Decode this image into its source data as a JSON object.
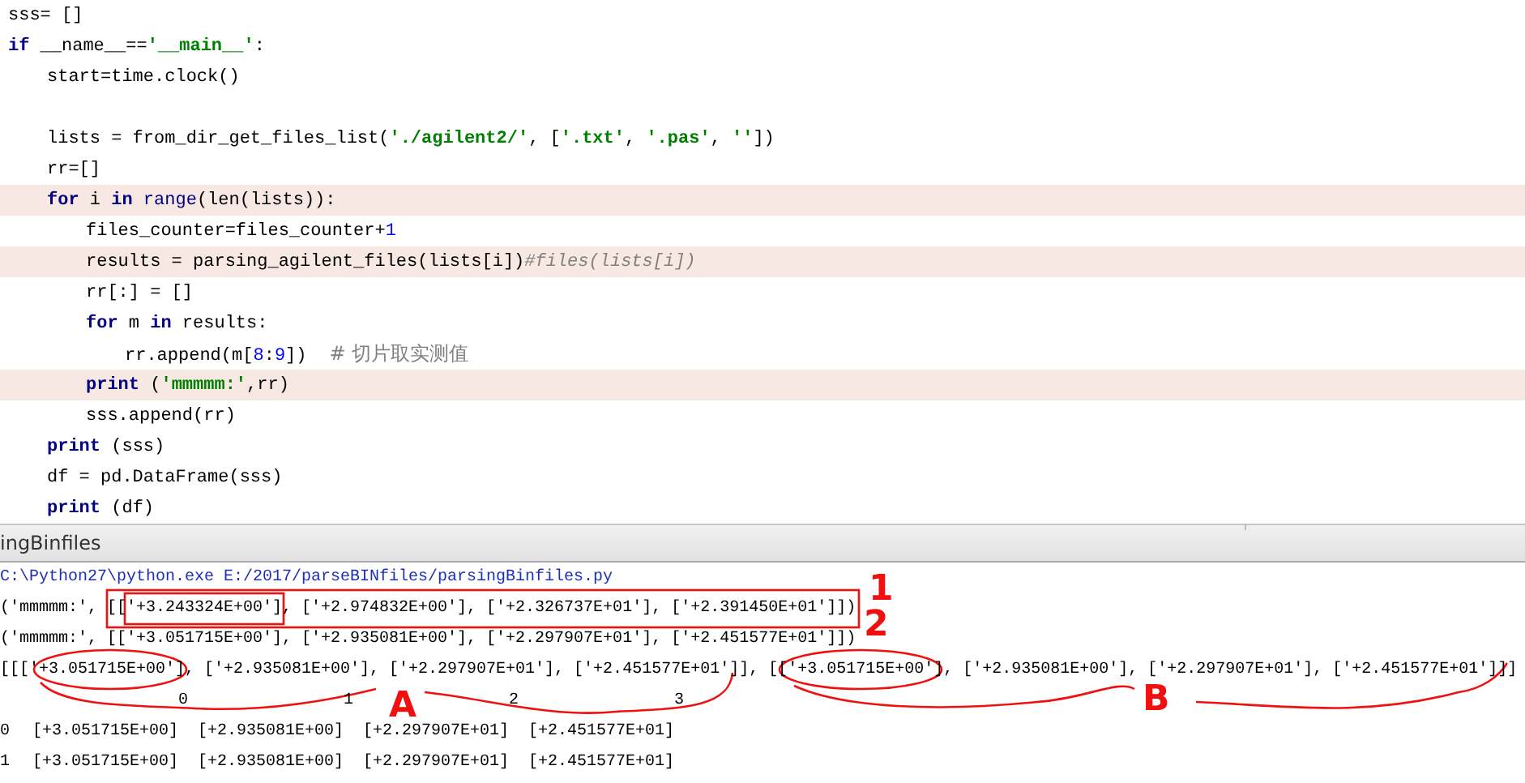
{
  "editor": {
    "lines": [
      {
        "kind": "code",
        "highlighted": false,
        "tokens": [
          {
            "kind": "plain",
            "text": "sss= []"
          }
        ]
      },
      {
        "kind": "code",
        "highlighted": false,
        "tokens": [
          {
            "kind": "keyword",
            "text": "if"
          },
          {
            "kind": "plain",
            "text": " __name__=="
          },
          {
            "kind": "string",
            "text": "'__main__'"
          },
          {
            "kind": "plain",
            "text": ":"
          }
        ],
        "children": [
          {
            "kind": "code",
            "highlighted": false,
            "tokens": [
              {
                "kind": "plain",
                "text": "start=time.clock()"
              }
            ]
          },
          {
            "kind": "blank"
          },
          {
            "kind": "code",
            "highlighted": false,
            "tokens": [
              {
                "kind": "plain",
                "text": "lists = from_dir_get_files_list("
              },
              {
                "kind": "string",
                "text": "'./agilent2/'"
              },
              {
                "kind": "plain",
                "text": ", ["
              },
              {
                "kind": "string",
                "text": "'.txt'"
              },
              {
                "kind": "plain",
                "text": ", "
              },
              {
                "kind": "string",
                "text": "'.pas'"
              },
              {
                "kind": "plain",
                "text": ", "
              },
              {
                "kind": "string",
                "text": "''"
              },
              {
                "kind": "plain",
                "text": "])"
              }
            ]
          },
          {
            "kind": "code",
            "highlighted": false,
            "tokens": [
              {
                "kind": "plain",
                "text": "rr=[]"
              }
            ]
          },
          {
            "kind": "code",
            "highlighted": true,
            "tokens": [
              {
                "kind": "keyword",
                "text": "for"
              },
              {
                "kind": "plain",
                "text": " i "
              },
              {
                "kind": "keyword",
                "text": "in"
              },
              {
                "kind": "builtin",
                "text": " range"
              },
              {
                "kind": "plain",
                "text": "(len(lists)):"
              }
            ],
            "children": [
              {
                "kind": "code",
                "highlighted": false,
                "tokens": [
                  {
                    "kind": "plain",
                    "text": "files_counter=files_counter+"
                  },
                  {
                    "kind": "number",
                    "text": "1"
                  }
                ]
              },
              {
                "kind": "code",
                "highlighted": true,
                "tokens": [
                  {
                    "kind": "plain",
                    "text": "results = parsing_agilent_files(lists[i])"
                  },
                  {
                    "kind": "comment",
                    "text": "#files(lists[i])"
                  }
                ]
              },
              {
                "kind": "code",
                "highlighted": false,
                "tokens": [
                  {
                    "kind": "plain",
                    "text": "rr[:] = []"
                  }
                ]
              },
              {
                "kind": "code",
                "highlighted": false,
                "tokens": [
                  {
                    "kind": "keyword",
                    "text": "for"
                  },
                  {
                    "kind": "plain",
                    "text": " m "
                  },
                  {
                    "kind": "keyword",
                    "text": "in"
                  },
                  {
                    "kind": "plain",
                    "text": " results:"
                  }
                ],
                "children": [
                  {
                    "kind": "code",
                    "highlighted": false,
                    "tokens": [
                      {
                        "kind": "plain",
                        "text": "rr.append(m["
                      },
                      {
                        "kind": "number",
                        "text": "8"
                      },
                      {
                        "kind": "plain",
                        "text": ":"
                      },
                      {
                        "kind": "number",
                        "text": "9"
                      },
                      {
                        "kind": "plain",
                        "text": "])"
                      },
                      {
                        "kind": "comment-cjk",
                        "text": "# 切片取实测值"
                      }
                    ]
                  }
                ]
              },
              {
                "kind": "code",
                "highlighted": true,
                "tokens": [
                  {
                    "kind": "keyword",
                    "text": "print"
                  },
                  {
                    "kind": "plain",
                    "text": " ("
                  },
                  {
                    "kind": "string",
                    "text": "'mmmmm:'"
                  },
                  {
                    "kind": "plain",
                    "text": ",rr)"
                  }
                ]
              },
              {
                "kind": "code",
                "highlighted": false,
                "tokens": [
                  {
                    "kind": "plain",
                    "text": "sss.append(rr)"
                  }
                ]
              }
            ]
          },
          {
            "kind": "code",
            "highlighted": false,
            "tokens": [
              {
                "kind": "keyword",
                "text": "print"
              },
              {
                "kind": "plain",
                "text": " (sss)"
              }
            ]
          },
          {
            "kind": "code",
            "highlighted": false,
            "tokens": [
              {
                "kind": "plain",
                "text": "df = pd.DataFrame(sss)"
              }
            ]
          },
          {
            "kind": "code",
            "highlighted": false,
            "tokens": [
              {
                "kind": "keyword",
                "text": "print"
              },
              {
                "kind": "plain",
                "text": " (df)"
              }
            ]
          }
        ]
      }
    ]
  },
  "console": {
    "tab_title": "ingBinfiles",
    "lines": [
      {
        "kind": "command",
        "text": "C:\\Python27\\python.exe E:/2017/parseBINfiles/parsingBinfiles.py"
      },
      {
        "kind": "output",
        "text": "('mmmmm:', [['+3.243324E+00'], ['+2.974832E+00'], ['+2.326737E+01'], ['+2.391450E+01']])"
      },
      {
        "kind": "output",
        "text": "('mmmmm:', [['+3.051715E+00'], ['+2.935081E+00'], ['+2.297907E+01'], ['+2.451577E+01']])"
      },
      {
        "kind": "output",
        "text": "[[['+3.051715E+00'], ['+2.935081E+00'], ['+2.297907E+01'], ['+2.451577E+01']], [['+3.051715E+00'], ['+2.935081E+00'], ['+2.297907E+01'], ['+2.451577E+01']]]"
      }
    ],
    "dataframe": {
      "columns": [
        "0",
        "1",
        "2",
        "3"
      ],
      "rows": [
        {
          "index": "0",
          "cells": [
            "[+3.051715E+00]",
            "[+2.935081E+00]",
            "[+2.297907E+01]",
            "[+2.451577E+01]"
          ]
        },
        {
          "index": "1",
          "cells": [
            "[+3.051715E+00]",
            "[+2.935081E+00]",
            "[+2.297907E+01]",
            "[+2.451577E+01]"
          ]
        }
      ]
    },
    "annotations": [
      {
        "text": "1"
      },
      {
        "text": "2"
      },
      {
        "text": "A"
      },
      {
        "text": "B"
      }
    ]
  }
}
